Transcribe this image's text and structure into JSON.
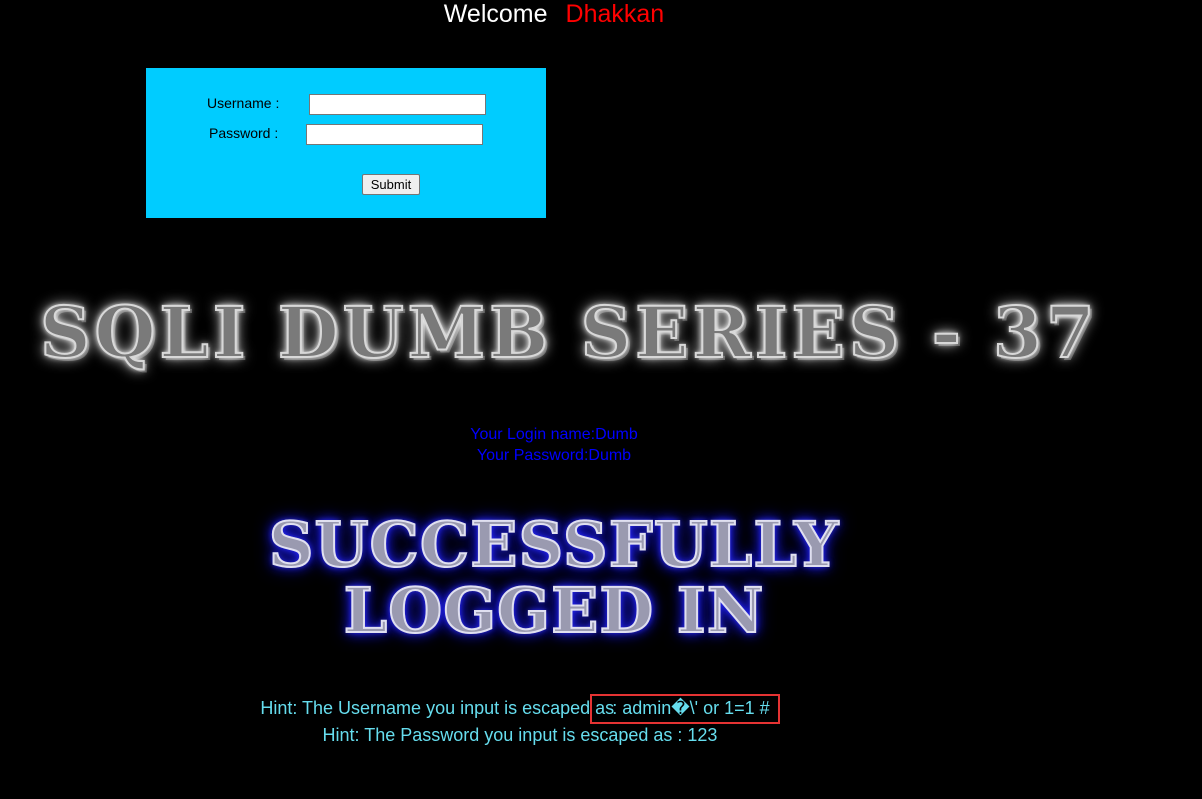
{
  "header": {
    "welcome": "Welcome",
    "name": "Dhakkan"
  },
  "login_form": {
    "username_label": "Username :",
    "password_label": "Password :",
    "username_value": "",
    "password_value": "",
    "submit_label": "Submit"
  },
  "banner": {
    "title": "SQLI DUMB SERIES - 37"
  },
  "result": {
    "login_name": "Your Login name:Dumb",
    "password": "Your Password:Dumb",
    "success_line1": "SUCCESSFULLY",
    "success_line2": "LOGGED IN"
  },
  "hints": {
    "username_prefix": "Hint: The Username you input is escaped as",
    "username_value": ": admin�\\' or 1=1 #",
    "password_line": "Hint: The Password you input is escaped as : 123"
  },
  "colors": {
    "background": "#000000",
    "form_background": "#00ccff",
    "name": "#ff0000",
    "login_info": "#0000ff",
    "hint_text": "#66ddee",
    "highlight_border": "#e53333"
  }
}
